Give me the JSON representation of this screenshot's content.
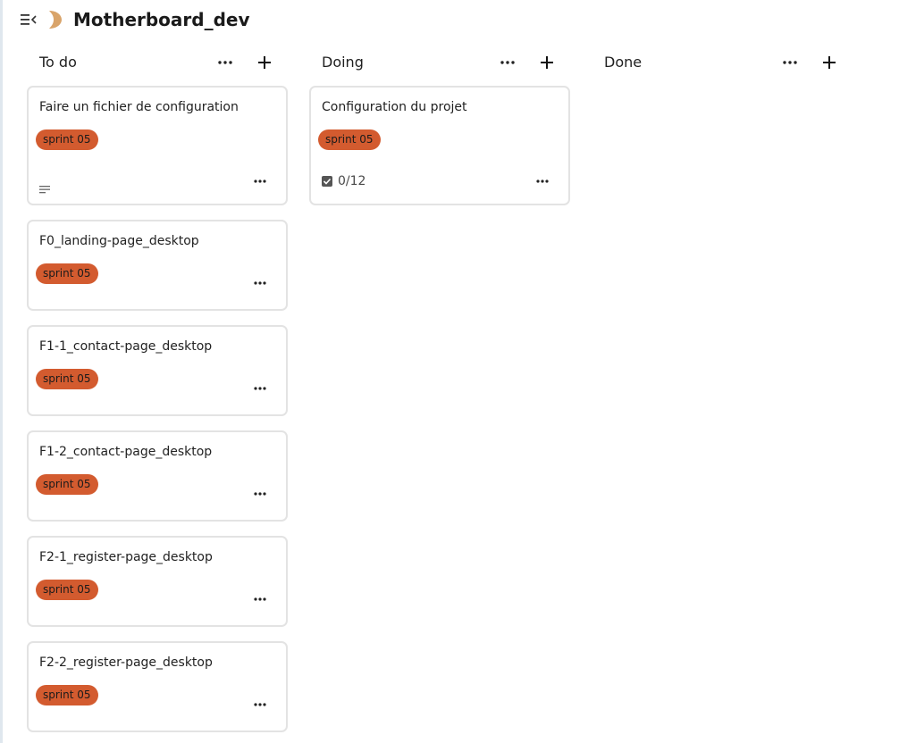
{
  "board": {
    "title": "Motherboard_dev"
  },
  "icons": {
    "menu": "menu-collapse-icon",
    "board": "board-moon-icon",
    "more": "more-horizontal-icon",
    "add": "plus-icon",
    "description": "description-lines-icon",
    "checklist": "checkbox-icon"
  },
  "colors": {
    "label": "#d35b2f",
    "card_border": "#e3e3e3"
  },
  "columns": [
    {
      "title": "To do",
      "cards": [
        {
          "title": "Faire un fichier de configuration",
          "label": "sprint 05"
        },
        {
          "title": "F0_landing-page_desktop",
          "label": "sprint 05"
        },
        {
          "title": "F1-1_contact-page_desktop",
          "label": "sprint 05"
        },
        {
          "title": "F1-2_contact-page_desktop",
          "label": "sprint 05"
        },
        {
          "title": "F2-1_register-page_desktop",
          "label": "sprint 05"
        },
        {
          "title": "F2-2_register-page_desktop",
          "label": "sprint 05"
        }
      ]
    },
    {
      "title": "Doing",
      "cards": [
        {
          "title": "Configuration du projet",
          "label": "sprint 05",
          "checklist": "0/12"
        }
      ]
    },
    {
      "title": "Done",
      "cards": []
    }
  ]
}
